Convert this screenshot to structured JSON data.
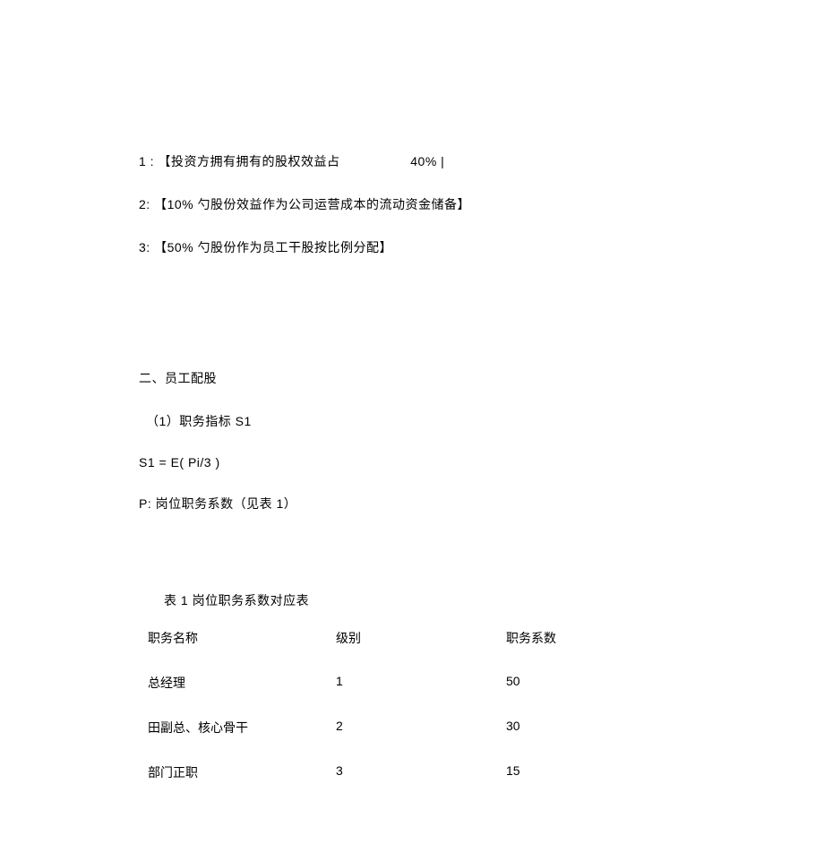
{
  "lines": {
    "l1a": "1 : 【投资方拥有拥有的股权效益占",
    "l1b": "40% |",
    "l2": "2: 【10% 勺股份效益作为公司运营成本的流动资金储备】",
    "l3": "3: 【50% 勺股份作为员工干股按比例分配】",
    "sec2_title": "二、员工配股",
    "sec2_sub1": "（1）职务指标 S1",
    "formula": "S1 = E( Pi/3 )",
    "p_desc": "P: 岗位职务系数（见表  1）",
    "table_caption": "表 1 岗位职务系数对应表"
  },
  "chart_data": {
    "type": "table",
    "title": "表 1 岗位职务系数对应表",
    "columns": [
      "职务名称",
      "级别",
      "职务系数"
    ],
    "rows": [
      {
        "name": "总经理",
        "level": "1",
        "coef": "50"
      },
      {
        "name": "田副总、核心骨干",
        "level": "2",
        "coef": "30"
      },
      {
        "name": "部门正职",
        "level": "3",
        "coef": "15"
      }
    ]
  }
}
